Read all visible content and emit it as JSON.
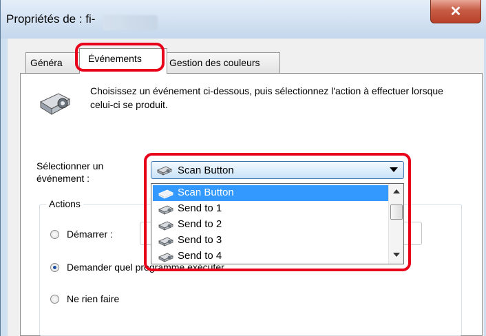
{
  "window": {
    "title": "Propriétés de : fi-",
    "close_glyph": "✕"
  },
  "tabs": [
    {
      "label": "Généra"
    },
    {
      "label": "Événements"
    },
    {
      "label": "Gestion des couleurs"
    }
  ],
  "panel": {
    "description": "Choisissez un événement ci-dessous, puis sélectionnez l'action à effectuer lorsque celui-ci se produit.",
    "select_label_line1": "Sélectionner un",
    "select_label_line2": "événement :",
    "selected_event": "Scan Button",
    "dropdown_items": [
      "Scan Button",
      "Send to 1",
      "Send to 2",
      "Send to 3",
      "Send to 4"
    ],
    "actions_title": "Actions",
    "radio_start": "Démarrer :",
    "radio_ask": "Demander quel programme exécuter",
    "radio_nothing": "Ne rien faire"
  },
  "colors": {
    "highlight": "#e8001a",
    "selection": "#3399ff"
  },
  "icons": [
    "scanner-icon",
    "scan-button-icon",
    "chevron-down-icon",
    "close-icon"
  ]
}
